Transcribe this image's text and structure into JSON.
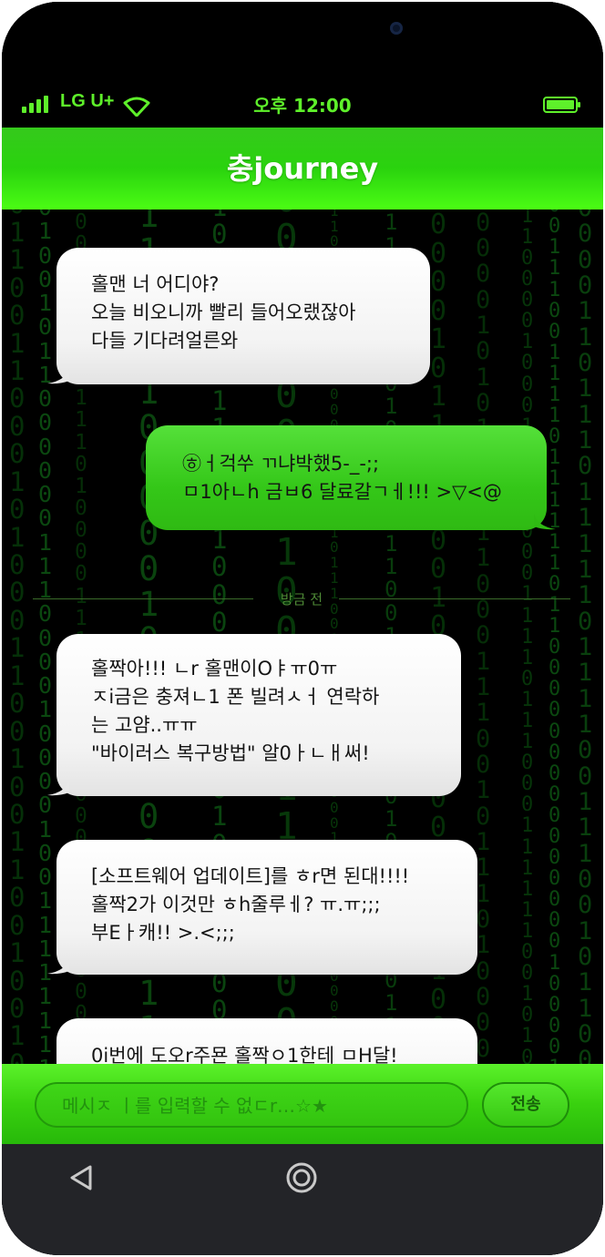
{
  "status_bar": {
    "carrier": "LG U+",
    "time": "오후 12:00",
    "signal_bars": 4,
    "wifi": true,
    "battery_level": 1.0,
    "accent_color": "#5ef02a"
  },
  "header": {
    "title": "충journey",
    "color": "#2ad30e"
  },
  "messages": [
    {
      "direction": "incoming",
      "lines": [
        "홀맨 너 어디야?",
        "오늘 비오니까 빨리 들어오랬잖아",
        "다들 기다려얼른와"
      ]
    },
    {
      "direction": "outgoing",
      "lines": [
        "㉭ㅓ걱쑤 ㄲ냐박했5-_-;;",
        "ㅁ1아ㄴh 금ㅂ6 달료갈ㄱㅔ!!! >▽<@"
      ]
    },
    {
      "direction": "incoming",
      "lines": [
        "홀짝아!!! ㄴr 홀맨이Оㅑㅠ0ㅠ",
        "ㅈi금은 충져ㄴ1 폰 빌려ㅅㅓ 연락하",
        "는 고얌..ㅠㅠ",
        "\"바이러스 복구방법\" 알0ㅏㄴㅐ써!"
      ]
    },
    {
      "direction": "incoming",
      "lines": [
        "[소프트웨어 업데이트]를 ㅎr면 된대!!!!",
        "홀짝2가 이것만 ㅎh줄루ㅔ? ㅠ.ㅠ;;;",
        "부Eㅏ캐!! >.<;;;"
      ]
    },
    {
      "direction": "incoming",
      "lines": [
        "0i번에 도오r주묜 홀짝ㅇ1한테 ㅁH달!"
      ]
    }
  ],
  "divider": {
    "label": "방금 전"
  },
  "input_bar": {
    "placeholder": "메시ㅈ ㅣ를 입력할 수 없ㄷr…☆★",
    "send_label": "전송"
  },
  "nav_bar": {
    "back_icon": "back-triangle-icon",
    "home_icon": "home-circle-icon"
  }
}
